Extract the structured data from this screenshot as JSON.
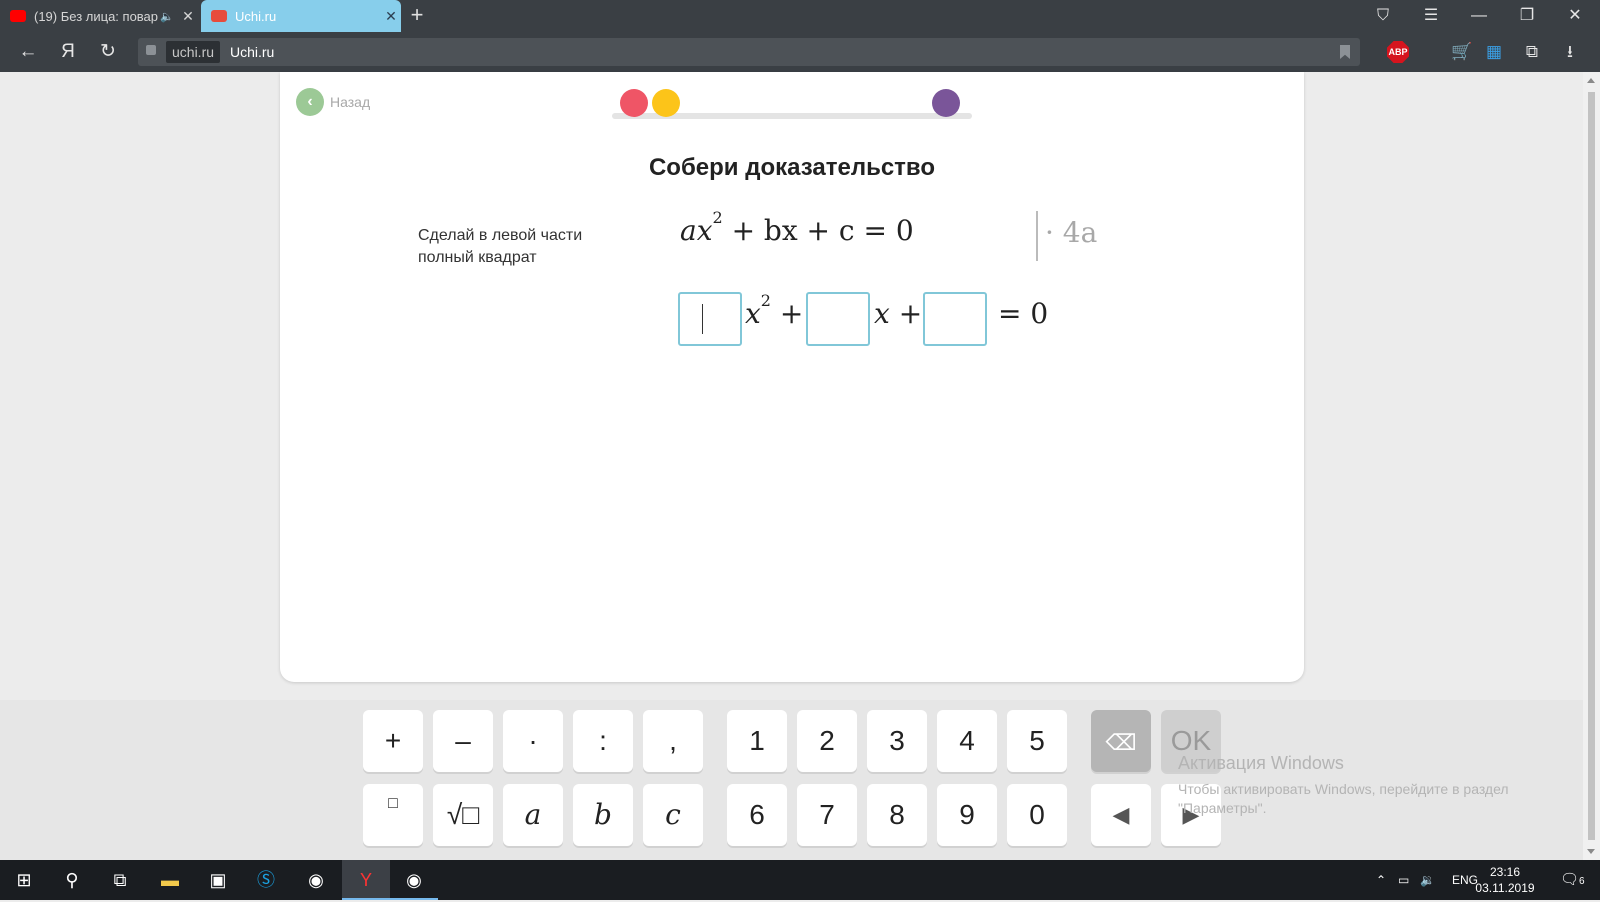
{
  "browser": {
    "tabs": [
      {
        "title": "(19) Без лица: повар",
        "icon": "youtube-icon",
        "icon_color": "#ff0000",
        "active": false,
        "muted_icon": "speaker-icon"
      },
      {
        "title": "Uchi.ru",
        "icon": "uchi-icon",
        "icon_color": "#e74c3c",
        "active": true
      }
    ],
    "new_tab_label": "+",
    "window_buttons": [
      "bookmarks-icon",
      "menu-icon",
      "minimize-icon",
      "restore-icon",
      "close-icon"
    ],
    "yandex_label": "Я",
    "address": {
      "domain": "uchi.ru",
      "title": "Uchi.ru"
    },
    "extensions": {
      "abp_label": "ABP"
    }
  },
  "page": {
    "back_label": "Назад",
    "progress_dots": [
      {
        "color": "#ef5566"
      },
      {
        "color": "#fcc419"
      },
      {
        "color": "#7a5599"
      }
    ],
    "title": "Собери доказательство",
    "instruction": "Сделай в левой части полный квадрат",
    "equation": {
      "lhs_a": "ax",
      "sup": "2",
      "rest": " + bx + c = 0",
      "multiplier": "· 4a"
    },
    "answer": {
      "x2": "x",
      "sup": "2",
      "plus1": " +",
      "x": "x",
      "plus2": " +",
      "rhs": "= 0"
    }
  },
  "keypad": {
    "row1": [
      "+",
      "–",
      "·",
      ":",
      ","
    ],
    "digits1": [
      "1",
      "2",
      "3",
      "4",
      "5"
    ],
    "row2": [
      "□",
      "√□",
      "a",
      "b",
      "c"
    ],
    "digits2": [
      "6",
      "7",
      "8",
      "9",
      "0"
    ],
    "backspace_icon": "backspace-icon",
    "ok_label": "OK",
    "left_arrow": "◀",
    "right_arrow": "▶"
  },
  "watermark": {
    "title": "Активация Windows",
    "line1": "Чтобы активировать Windows, перейдите в раздел",
    "line2": "\"Параметры\"."
  },
  "taskbar": {
    "lang": "ENG",
    "time": "23:16",
    "date": "03.11.2019",
    "notifications": "6"
  }
}
